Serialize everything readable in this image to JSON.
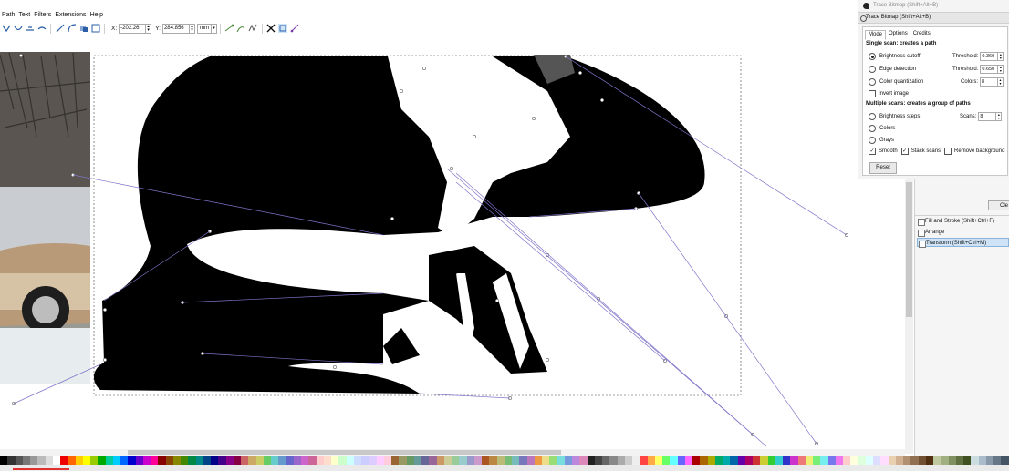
{
  "menu": {
    "items": [
      "Path",
      "Text",
      "Filters",
      "Extensions",
      "Help"
    ]
  },
  "toolbar": {
    "x_label": "X:",
    "x_value": "-202.26",
    "y_label": "Y:",
    "y_value": "284.856",
    "unit": "mm"
  },
  "trace_dialog": {
    "title": "Trace Bitmap (Shift+Alt+B)",
    "subtitle": "Trace Bitmap (Shift+Alt+B)",
    "tabs": [
      "Mode",
      "Options",
      "Credits"
    ],
    "active_tab": "Mode",
    "single_scan_header": "Single scan: creates a path",
    "brightness_cutoff": "Brightness cutoff",
    "threshold_label": "Threshold:",
    "brightness_threshold": "0.360",
    "edge_detection": "Edge detection",
    "edge_threshold_label": "Threshold:",
    "edge_threshold": "0.650",
    "color_quantization": "Color quantization",
    "colors_label": "Colors:",
    "colors_value": "8",
    "invert_image": "Invert image",
    "multi_scan_header": "Multiple scans: creates a group of paths",
    "brightness_steps": "Brightness steps",
    "scans_label": "Scans:",
    "scans_value": "8",
    "colors_option": "Colors",
    "grays_option": "Grays",
    "smooth": "Smooth",
    "stack_scans": "Stack scans",
    "remove_background": "Remove background",
    "reset_button": "Reset",
    "selected_mode": "Brightness cutoff",
    "smooth_checked": true,
    "stack_scans_checked": true,
    "remove_background_checked": false,
    "invert_checked": false
  },
  "dock": {
    "clear_button": "Cle",
    "items": [
      "Fill and Stroke (Shift+Ctrl+F)",
      "Arrange",
      "Transform (Shift+Ctrl+M)"
    ],
    "active_item": "Transform (Shift+Ctrl+M)"
  },
  "colors": {
    "accent": "#8ab3dc",
    "path_handle_line": "#7f74c9",
    "trace_fill": "#000000"
  }
}
